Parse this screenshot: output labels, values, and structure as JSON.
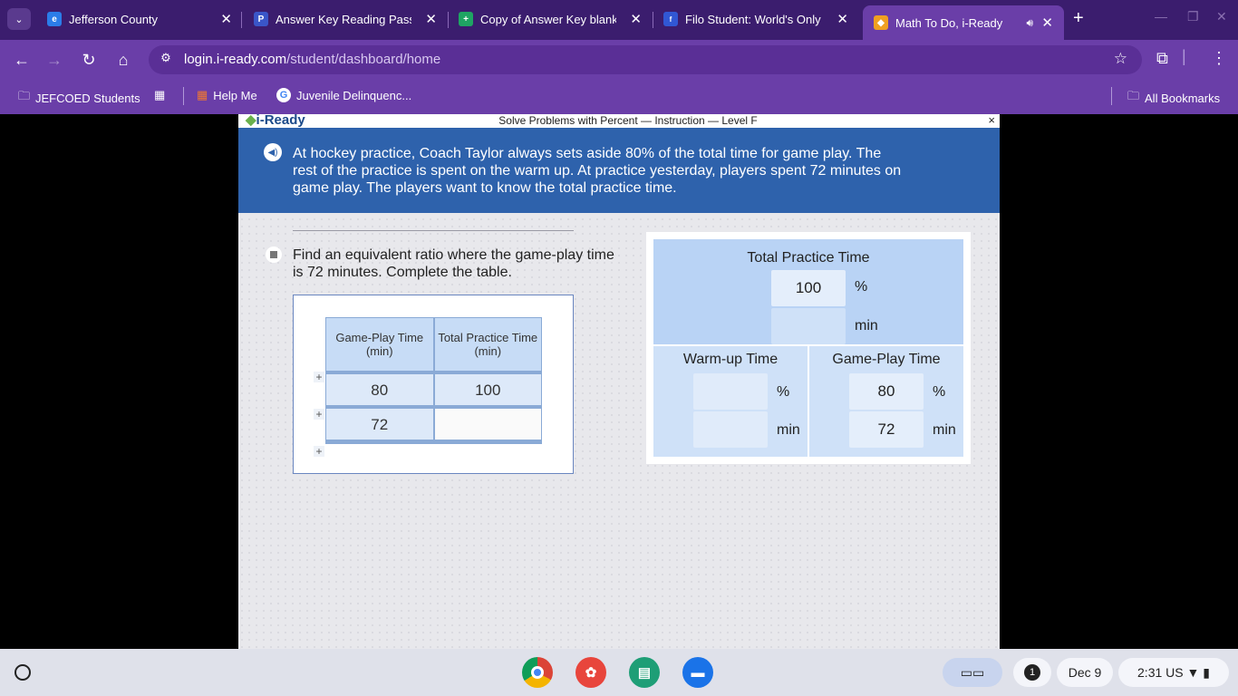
{
  "tabs": [
    {
      "title": "Jefferson County",
      "icon": "edge-blue-icon",
      "color": "#2b7de9"
    },
    {
      "title": "Answer Key Reading Passa",
      "icon": "pearson-p-icon",
      "color": "#3a56c8"
    },
    {
      "title": "Copy of Answer Key blank -",
      "icon": "sheets-plus-icon",
      "color": "#1fa463"
    },
    {
      "title": "Filo Student: World's Only L",
      "icon": "filo-icon",
      "color": "#3157d4"
    },
    {
      "title": "Math To Do, i-Ready",
      "icon": "iready-cube-icon",
      "color": "#f0a020"
    }
  ],
  "address": {
    "host": "login.i-ready.com",
    "path": "/student/dashboard/home"
  },
  "bookmarks": {
    "items": [
      {
        "label": "JEFCOED Students"
      },
      {
        "label": "Help Me"
      },
      {
        "label": "Juvenile Delinquenc..."
      }
    ],
    "all": "All Bookmarks"
  },
  "lesson": {
    "brand": "i-Ready",
    "title": "Solve Problems with Percent — Instruction — Level F",
    "close": "×",
    "problem": "At hockey practice, Coach Taylor always sets aside 80% of the total time for game play. The rest of the practice is spent on the warm up. At practice yesterday, players spent 72 minutes on game play. The players want to know the total practice time.",
    "prompt": "Find an equivalent ratio where the game-play time is 72 minutes. Complete the table.",
    "ratio_table": {
      "headers": [
        "Game-Play Time (min)",
        "Total Practice Time (min)"
      ],
      "rows": [
        [
          "80",
          "100"
        ],
        [
          "72",
          ""
        ]
      ]
    },
    "bar_model": {
      "total_label": "Total Practice Time",
      "total_percent": "100",
      "total_min": "",
      "warmup_label": "Warm-up Time",
      "warmup_percent": "",
      "warmup_min": "",
      "gameplay_label": "Game-Play Time",
      "gameplay_percent": "80",
      "gameplay_min": "72",
      "unit_percent": "%",
      "unit_min": "min"
    }
  },
  "shelf": {
    "notifications": "1",
    "date": "Dec 9",
    "time": "2:31",
    "region": "US"
  }
}
